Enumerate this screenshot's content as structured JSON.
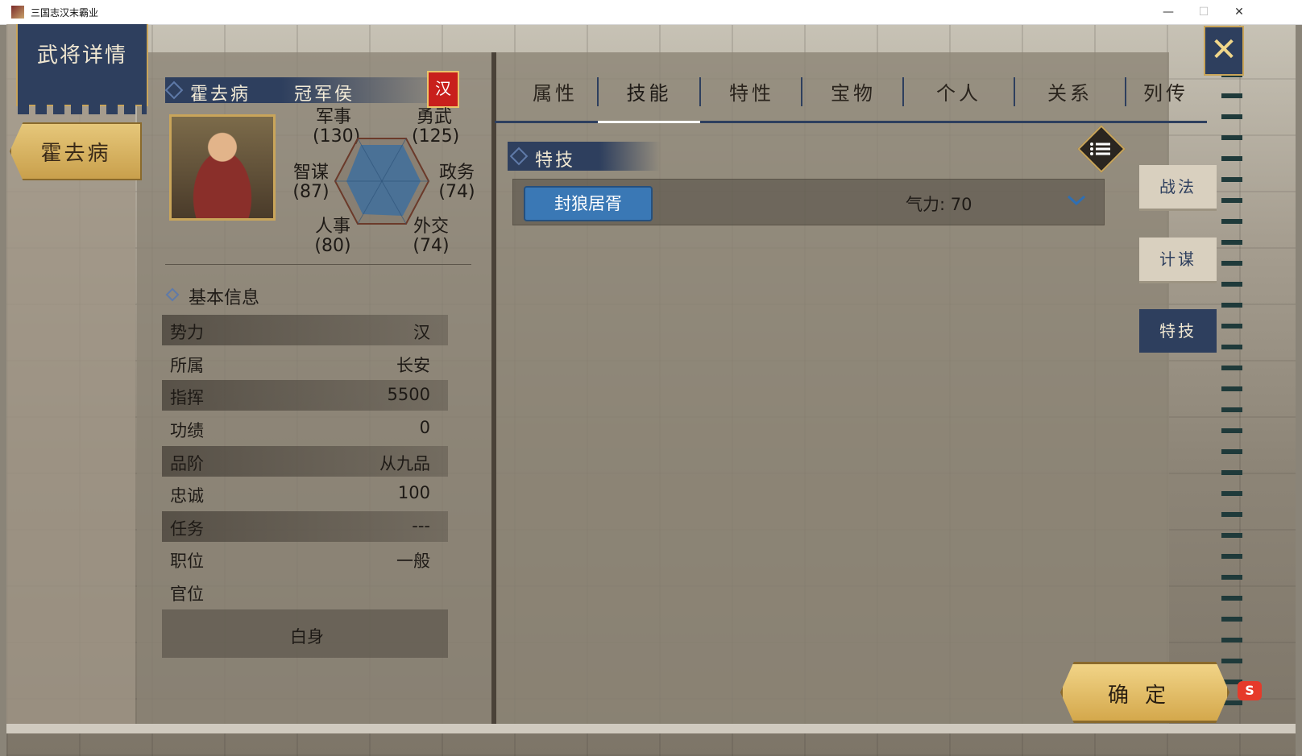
{
  "window": {
    "title": "三国志汉末霸业",
    "minimize": "—",
    "maximize": "☐",
    "close": "✕"
  },
  "banner": {
    "title": "武将详情"
  },
  "general": {
    "name": "霍去病",
    "title": "冠军侯",
    "faction_badge": "汉",
    "stats": {
      "military": {
        "label": "军事",
        "value": "(130)"
      },
      "valor": {
        "label": "勇武",
        "value": "(125)"
      },
      "intellect": {
        "label": "智谋",
        "value": "(87)"
      },
      "politics": {
        "label": "政务",
        "value": "(74)"
      },
      "personnel": {
        "label": "人事",
        "value": "(80)"
      },
      "diplomacy": {
        "label": "外交",
        "value": "(74)"
      }
    }
  },
  "basic_info": {
    "header": "基本信息",
    "rows": [
      {
        "key": "势力",
        "value": "汉"
      },
      {
        "key": "所属",
        "value": "长安"
      },
      {
        "key": "指挥",
        "value": "5500"
      },
      {
        "key": "功绩",
        "value": "0"
      },
      {
        "key": "品阶",
        "value": "从九品"
      },
      {
        "key": "忠诚",
        "value": "100"
      },
      {
        "key": "任务",
        "value": "---"
      },
      {
        "key": "职位",
        "value": "一般"
      },
      {
        "key": "官位",
        "value": ""
      }
    ],
    "rank": "白身"
  },
  "tabs": [
    "属性",
    "技能",
    "特性",
    "宝物",
    "个人",
    "关系",
    "列传"
  ],
  "active_tab": "技能",
  "skills": {
    "section": "特技",
    "items": [
      {
        "name": "封狼居胥",
        "cost": "气力: 70"
      }
    ]
  },
  "side_tabs": [
    "战法",
    "计谋",
    "特技"
  ],
  "active_side_tab": "特技",
  "confirm": "确定",
  "colors": {
    "navy": "#2e3f5e",
    "gold": "#c9a55a",
    "skill_button": "#3a78b5",
    "faction_red": "#c8201c"
  }
}
